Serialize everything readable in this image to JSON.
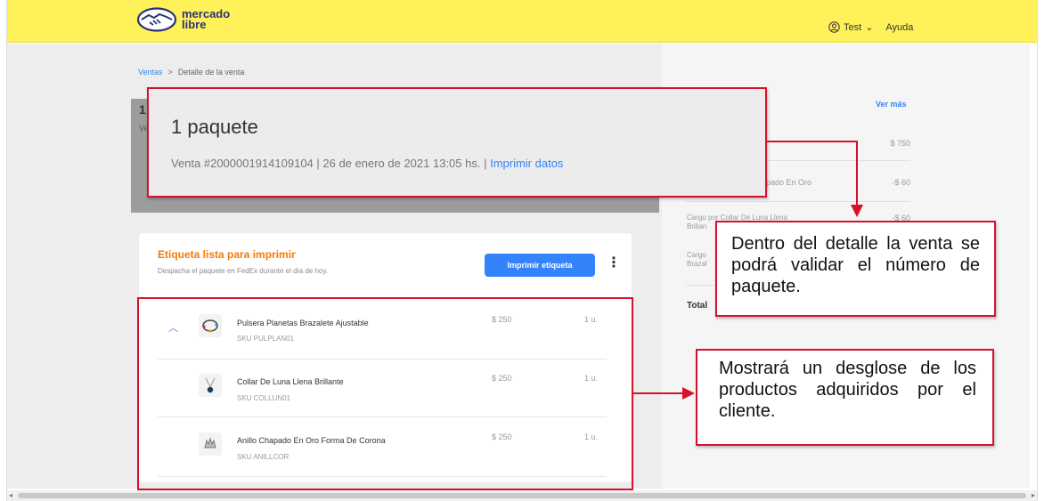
{
  "header": {
    "logo_line1": "mercado",
    "logo_line2": "libre",
    "user_name": "Test",
    "user_caret": "⌄",
    "help_label": "Ayuda"
  },
  "breadcrumb": {
    "parent": "Ventas",
    "separator": ">",
    "current": "Detalle de la venta"
  },
  "background_header": {
    "title_fragment": "1",
    "subtitle_fragment": "Ve"
  },
  "package": {
    "title": "1 paquete",
    "meta": "Venta #2000001914109104 | 26 de enero de 2021 13:05 hs. | ",
    "print_link": "Imprimir datos"
  },
  "label_card": {
    "title": "Etiqueta lista para imprimir",
    "subtitle": "Despacha el paquete en FedEx durante el día de hoy.",
    "print_button": "Imprimir etiqueta",
    "more_menu": "⋮"
  },
  "products": [
    {
      "name": "Pulsera Planetas Brazalete Ajustable",
      "sku": "SKU PULPLAN01",
      "price": "$ 250",
      "qty": "1 u."
    },
    {
      "name": "Collar De Luna Llena Brillante",
      "sku": "SKU COLLUN01",
      "price": "$ 250",
      "qty": "1 u."
    },
    {
      "name": "Anillo Chapado En Oro Forma De Corona",
      "sku": "SKU ANILLCOR",
      "price": "$ 250",
      "qty": "1 u."
    }
  ],
  "summary": {
    "ver_mas": "Ver más",
    "amount_1": "$ 750",
    "charge_1_fragment": "pado En Oro",
    "amount_2": "-$ 60",
    "charge_2_line1": "Cargo por Collar De Luna Llena",
    "charge_2_line2": "Brillan",
    "amount_3": "-$ 60",
    "charge_3_line1": "Cargo",
    "charge_3_line2": "Brazal",
    "total_label": "Total"
  },
  "annotations": {
    "note_1": "Dentro del detalle la venta se podrá validar el número de paquete.",
    "note_2": "Mostrará un desglose de los productos adquiridos por el cliente."
  },
  "colors": {
    "header_yellow": "#fff159",
    "accent_blue": "#3483fa",
    "label_orange": "#f57c00",
    "annotation_red": "#d7102b"
  }
}
